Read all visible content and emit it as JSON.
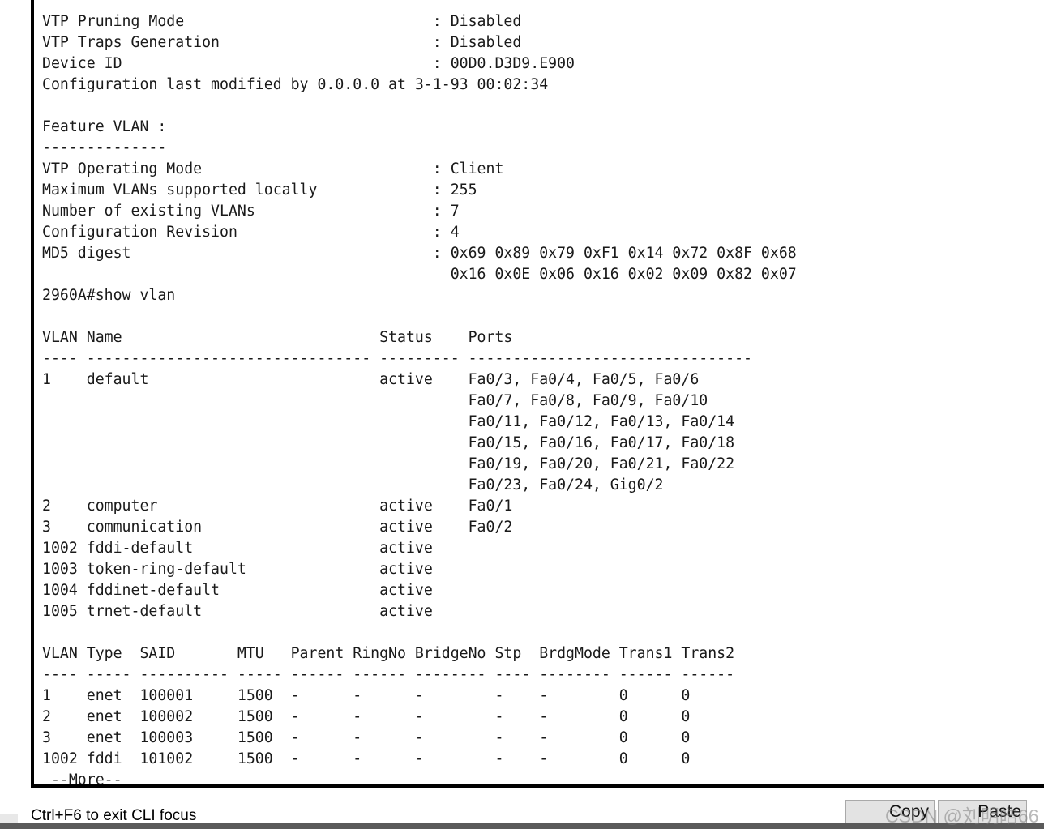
{
  "terminal": {
    "prompt_command": "2960A#show vlan",
    "more_prompt": "--More--",
    "clipped_top_line": "",
    "vtp_status": [
      {
        "label": "VTP Pruning Mode",
        "sep": ":",
        "value": "Disabled"
      },
      {
        "label": "VTP Traps Generation",
        "sep": ":",
        "value": "Disabled"
      },
      {
        "label": "Device ID",
        "sep": ":",
        "value": "00D0.D3D9.E900"
      }
    ],
    "config_modified_line": "Configuration last modified by 0.0.0.0 at 3-1-93 00:02:34",
    "feature_heading": "Feature VLAN :",
    "feature_underline": "--------------",
    "feature_vlan": [
      {
        "label": "VTP Operating Mode",
        "sep": ":",
        "value": "Client"
      },
      {
        "label": "Maximum VLANs supported locally",
        "sep": ":",
        "value": "255"
      },
      {
        "label": "Number of existing VLANs",
        "sep": ":",
        "value": "7"
      },
      {
        "label": "Configuration Revision",
        "sep": ":",
        "value": "4"
      },
      {
        "label": "MD5 digest",
        "sep": ":",
        "value": "0x69 0x89 0x79 0xF1 0x14 0x72 0x8F 0x68"
      }
    ],
    "md5_digest_line2": "0x16 0x0E 0x06 0x16 0x02 0x09 0x82 0x07",
    "vlan_table": {
      "headers": [
        "VLAN",
        "Name",
        "Status",
        "Ports"
      ],
      "separator": "---- -------------------------------- --------- --------------------------------",
      "rows": [
        {
          "vlan": "1",
          "name": "default",
          "status": "active",
          "ports": [
            "Fa0/3, Fa0/4, Fa0/5, Fa0/6",
            "Fa0/7, Fa0/8, Fa0/9, Fa0/10",
            "Fa0/11, Fa0/12, Fa0/13, Fa0/14",
            "Fa0/15, Fa0/16, Fa0/17, Fa0/18",
            "Fa0/19, Fa0/20, Fa0/21, Fa0/22",
            "Fa0/23, Fa0/24, Gig0/2"
          ]
        },
        {
          "vlan": "2",
          "name": "computer",
          "status": "active",
          "ports": [
            "Fa0/1"
          ]
        },
        {
          "vlan": "3",
          "name": "communication",
          "status": "active",
          "ports": [
            "Fa0/2"
          ]
        },
        {
          "vlan": "1002",
          "name": "fddi-default",
          "status": "active",
          "ports": []
        },
        {
          "vlan": "1003",
          "name": "token-ring-default",
          "status": "active",
          "ports": []
        },
        {
          "vlan": "1004",
          "name": "fddinet-default",
          "status": "active",
          "ports": []
        },
        {
          "vlan": "1005",
          "name": "trnet-default",
          "status": "active",
          "ports": []
        }
      ]
    },
    "vlan_detail_table": {
      "headers": [
        "VLAN",
        "Type",
        "SAID",
        "MTU",
        "Parent",
        "RingNo",
        "BridgeNo",
        "Stp",
        "BrdgMode",
        "Trans1",
        "Trans2"
      ],
      "separator": "---- ----- ---------- ----- ------ ------ -------- ---- -------- ------ ------",
      "rows": [
        {
          "vlan": "1",
          "type": "enet",
          "said": "100001",
          "mtu": "1500",
          "parent": "-",
          "ringno": "-",
          "bridgeno": "-",
          "stp": "-",
          "brdgmode": "-",
          "trans1": "0",
          "trans2": "0"
        },
        {
          "vlan": "2",
          "type": "enet",
          "said": "100002",
          "mtu": "1500",
          "parent": "-",
          "ringno": "-",
          "bridgeno": "-",
          "stp": "-",
          "brdgmode": "-",
          "trans1": "0",
          "trans2": "0"
        },
        {
          "vlan": "3",
          "type": "enet",
          "said": "100003",
          "mtu": "1500",
          "parent": "-",
          "ringno": "-",
          "bridgeno": "-",
          "stp": "-",
          "brdgmode": "-",
          "trans1": "0",
          "trans2": "0"
        },
        {
          "vlan": "1002",
          "type": "fddi",
          "said": "101002",
          "mtu": "1500",
          "parent": "-",
          "ringno": "-",
          "bridgeno": "-",
          "stp": "-",
          "brdgmode": "-",
          "trans1": "0",
          "trans2": "0"
        }
      ]
    }
  },
  "chrome": {
    "cli_focus_hint": "Ctrl+F6 to exit CLI focus",
    "copy_label": "Copy",
    "paste_label": "Paste"
  },
  "watermark": {
    "text": "CSDN @刘明皓66"
  },
  "colors": {
    "background": "#ffffff",
    "text": "#1a1a1a",
    "border": "#000000",
    "button_face": "#e3e3e3",
    "bottom_bar": "#5a5a5a"
  }
}
